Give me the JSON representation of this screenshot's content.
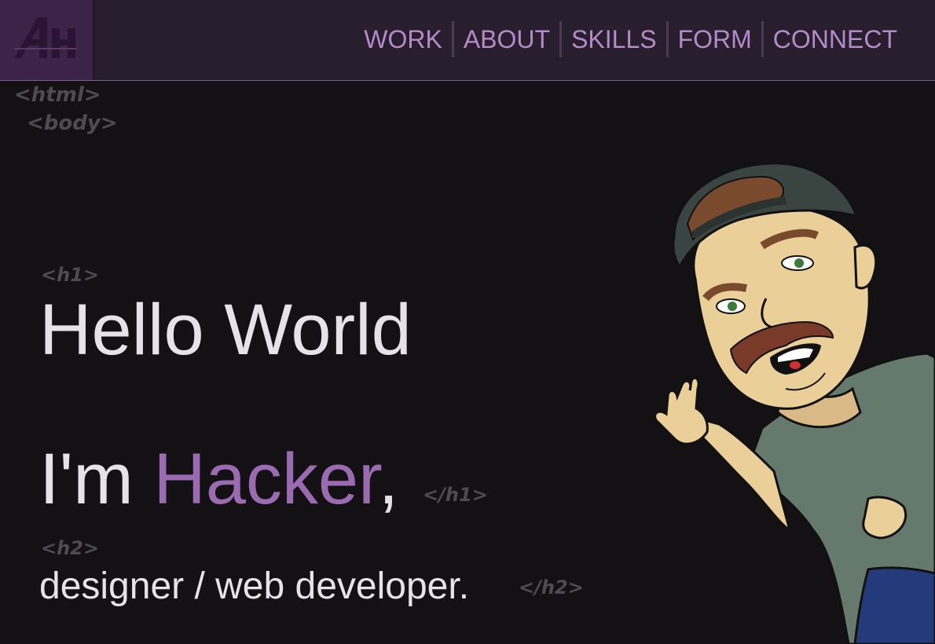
{
  "logo": {
    "text": "AH"
  },
  "nav": {
    "items": [
      {
        "label": "WORK"
      },
      {
        "label": "ABOUT"
      },
      {
        "label": "SKILLS"
      },
      {
        "label": "FORM"
      },
      {
        "label": "CONNECT"
      }
    ]
  },
  "tags": {
    "html_open": "<html>",
    "body_open": "<body>",
    "h1_open": "<h1>",
    "h1_close": "</h1>",
    "h2_open": "<h2>",
    "h2_close": "</h2>"
  },
  "hero": {
    "line1": "Hello World",
    "line2_prefix": "I'm ",
    "line2_name": "Hacker",
    "line2_suffix": ",",
    "subtitle": "designer / web developer."
  },
  "colors": {
    "background": "#141115",
    "header": "#281e2e",
    "nav_text": "#b38bc8",
    "accent": "#9b6bb2",
    "tag_text": "#4f4a52"
  }
}
